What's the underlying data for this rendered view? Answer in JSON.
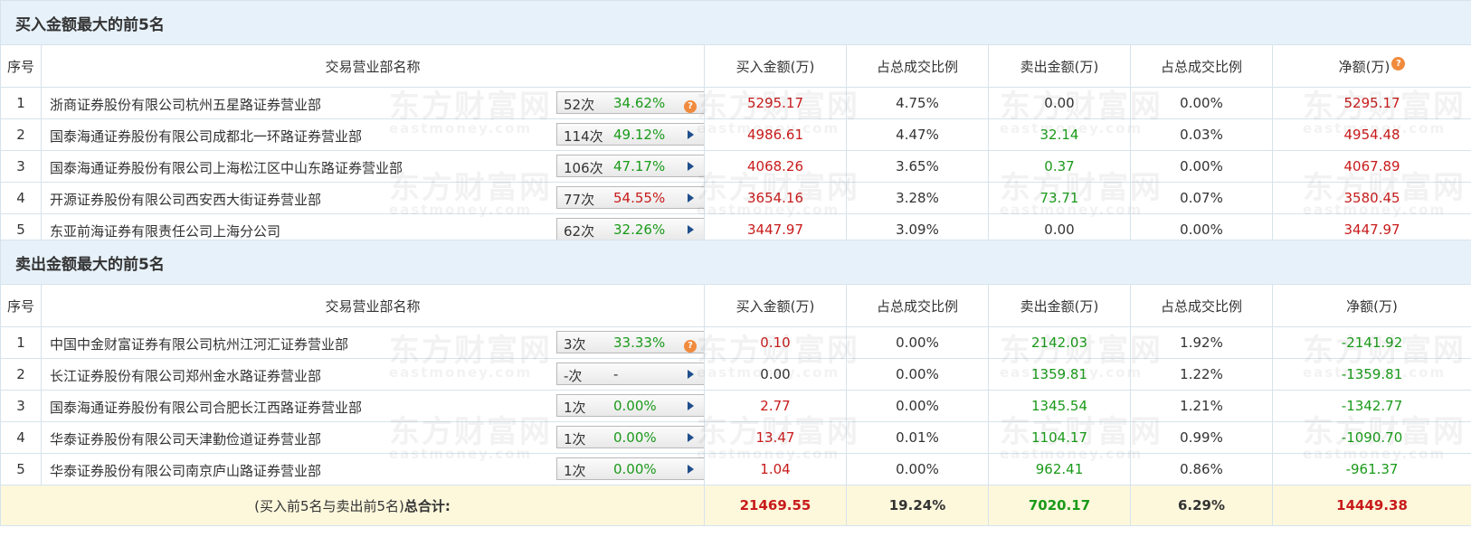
{
  "columns": [
    "序号",
    "交易营业部名称",
    "买入金额(万)",
    "占总成交比例",
    "卖出金额(万)",
    "占总成交比例",
    "净额(万)"
  ],
  "buy_section": {
    "title": "买入金额最大的前5名",
    "rows": [
      {
        "idx": "1",
        "name": "浙商证券股份有限公司杭州五星路证券营业部",
        "count": "52次",
        "pct": "34.62%",
        "pct_color": "green",
        "icon": "question",
        "buy": "5295.17",
        "buy_color": "red",
        "buy_ratio": "4.75%",
        "sell": "0.00",
        "sell_color": "dark",
        "sell_ratio": "0.00%",
        "net": "5295.17",
        "net_color": "red"
      },
      {
        "idx": "2",
        "name": "国泰海通证券股份有限公司成都北一环路证券营业部",
        "count": "114次",
        "pct": "49.12%",
        "pct_color": "green",
        "icon": "arrow",
        "buy": "4986.61",
        "buy_color": "red",
        "buy_ratio": "4.47%",
        "sell": "32.14",
        "sell_color": "green",
        "sell_ratio": "0.03%",
        "net": "4954.48",
        "net_color": "red"
      },
      {
        "idx": "3",
        "name": "国泰海通证券股份有限公司上海松江区中山东路证券营业部",
        "count": "106次",
        "pct": "47.17%",
        "pct_color": "green",
        "icon": "arrow",
        "buy": "4068.26",
        "buy_color": "red",
        "buy_ratio": "3.65%",
        "sell": "0.37",
        "sell_color": "green",
        "sell_ratio": "0.00%",
        "net": "4067.89",
        "net_color": "red"
      },
      {
        "idx": "4",
        "name": "开源证券股份有限公司西安西大街证券营业部",
        "count": "77次",
        "pct": "54.55%",
        "pct_color": "red",
        "icon": "arrow",
        "buy": "3654.16",
        "buy_color": "red",
        "buy_ratio": "3.28%",
        "sell": "73.71",
        "sell_color": "green",
        "sell_ratio": "0.07%",
        "net": "3580.45",
        "net_color": "red"
      },
      {
        "idx": "5",
        "name": "东亚前海证券有限责任公司上海分公司",
        "count": "62次",
        "pct": "32.26%",
        "pct_color": "green",
        "icon": "arrow",
        "buy": "3447.97",
        "buy_color": "red",
        "buy_ratio": "3.09%",
        "sell": "0.00",
        "sell_color": "dark",
        "sell_ratio": "0.00%",
        "net": "3447.97",
        "net_color": "red"
      }
    ]
  },
  "sell_section": {
    "title": "卖出金额最大的前5名",
    "rows": [
      {
        "idx": "1",
        "name": "中国中金财富证券有限公司杭州江河汇证券营业部",
        "count": "3次",
        "pct": "33.33%",
        "pct_color": "green",
        "icon": "question",
        "buy": "0.10",
        "buy_color": "red",
        "buy_ratio": "0.00%",
        "sell": "2142.03",
        "sell_color": "green",
        "sell_ratio": "1.92%",
        "net": "-2141.92",
        "net_color": "green"
      },
      {
        "idx": "2",
        "name": "长江证券股份有限公司郑州金水路证券营业部",
        "count": "-次",
        "pct": "-",
        "pct_color": "dark",
        "icon": "arrow",
        "buy": "0.00",
        "buy_color": "dark",
        "buy_ratio": "0.00%",
        "sell": "1359.81",
        "sell_color": "green",
        "sell_ratio": "1.22%",
        "net": "-1359.81",
        "net_color": "green"
      },
      {
        "idx": "3",
        "name": "国泰海通证券股份有限公司合肥长江西路证券营业部",
        "count": "1次",
        "pct": "0.00%",
        "pct_color": "green",
        "icon": "arrow",
        "buy": "2.77",
        "buy_color": "red",
        "buy_ratio": "0.00%",
        "sell": "1345.54",
        "sell_color": "green",
        "sell_ratio": "1.21%",
        "net": "-1342.77",
        "net_color": "green"
      },
      {
        "idx": "4",
        "name": "华泰证券股份有限公司天津勤俭道证券营业部",
        "count": "1次",
        "pct": "0.00%",
        "pct_color": "green",
        "icon": "arrow",
        "buy": "13.47",
        "buy_color": "red",
        "buy_ratio": "0.01%",
        "sell": "1104.17",
        "sell_color": "green",
        "sell_ratio": "0.99%",
        "net": "-1090.70",
        "net_color": "green"
      },
      {
        "idx": "5",
        "name": "华泰证券股份有限公司南京庐山路证券营业部",
        "count": "1次",
        "pct": "0.00%",
        "pct_color": "green",
        "icon": "arrow",
        "buy": "1.04",
        "buy_color": "red",
        "buy_ratio": "0.00%",
        "sell": "962.41",
        "sell_color": "green",
        "sell_ratio": "0.86%",
        "net": "-961.37",
        "net_color": "green"
      }
    ]
  },
  "total": {
    "label_prefix": "(买入前5名与卖出前5名)",
    "label_bold": "总合计:",
    "buy": "21469.55",
    "buy_ratio": "19.24%",
    "sell": "7020.17",
    "sell_ratio": "6.29%",
    "net": "14449.38"
  },
  "watermark": {
    "cn": "东方财富网",
    "en": "eastmoney.com"
  },
  "colors": {
    "red": "#c81b1b",
    "green": "#1a9a1a",
    "header_bg": "#e7f1f9",
    "total_bg": "#fdf8dc",
    "border": "#d6e3ec",
    "help_icon": "#f08a3d"
  }
}
